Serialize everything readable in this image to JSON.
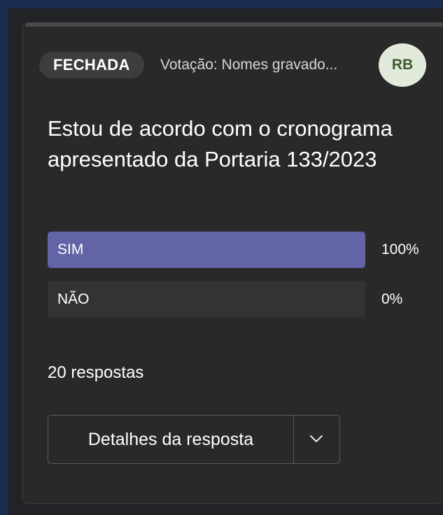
{
  "card": {
    "status_badge": "FECHADA",
    "subtitle": "Votação: Nomes gravado...",
    "avatar_initials": "RB",
    "question": "Estou de acordo com o cronograma apresentado da Portaria 133/2023",
    "options": [
      {
        "label": "SIM",
        "percent_label": "100%",
        "fraction": 1.0
      },
      {
        "label": "NÃO",
        "percent_label": "0%",
        "fraction": 0.0
      }
    ],
    "responses_text": "20 respostas",
    "details_button": "Detalhes da resposta"
  },
  "colors": {
    "accent": "#6264a7",
    "avatar_bg": "#e2ebdb",
    "avatar_fg": "#3c5a2f"
  },
  "icons": {
    "details_toggle": "chevron-down-icon"
  }
}
